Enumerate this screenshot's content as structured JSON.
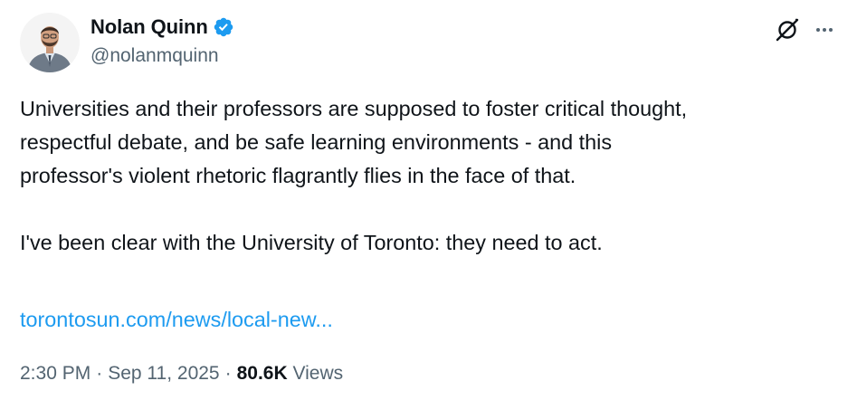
{
  "author": {
    "display_name": "Nolan Quinn",
    "handle": "@nolanmquinn",
    "verified_icon": "verified-badge-icon",
    "avatar_icon": "avatar"
  },
  "actions": {
    "grok_icon": "grok-icon",
    "more_icon": "more-options-icon"
  },
  "post": {
    "paragraph_1": "Universities and their professors are supposed to foster critical thought,\nrespectful debate, and be safe learning environments - and this\nprofessor's violent rhetoric flagrantly flies in the face of that.",
    "paragraph_2": "I've been clear with the University of Toronto: they need to act.",
    "link_text": "torontosun.com/news/local-new..."
  },
  "meta": {
    "time": "2:30 PM",
    "separator": "·",
    "date": "Sep 11, 2025",
    "views_count": "80.6K",
    "views_label": "Views"
  },
  "colors": {
    "text": "#0f1419",
    "secondary": "#536471",
    "link": "#1d9bf0",
    "verified": "#1d9bf0"
  }
}
